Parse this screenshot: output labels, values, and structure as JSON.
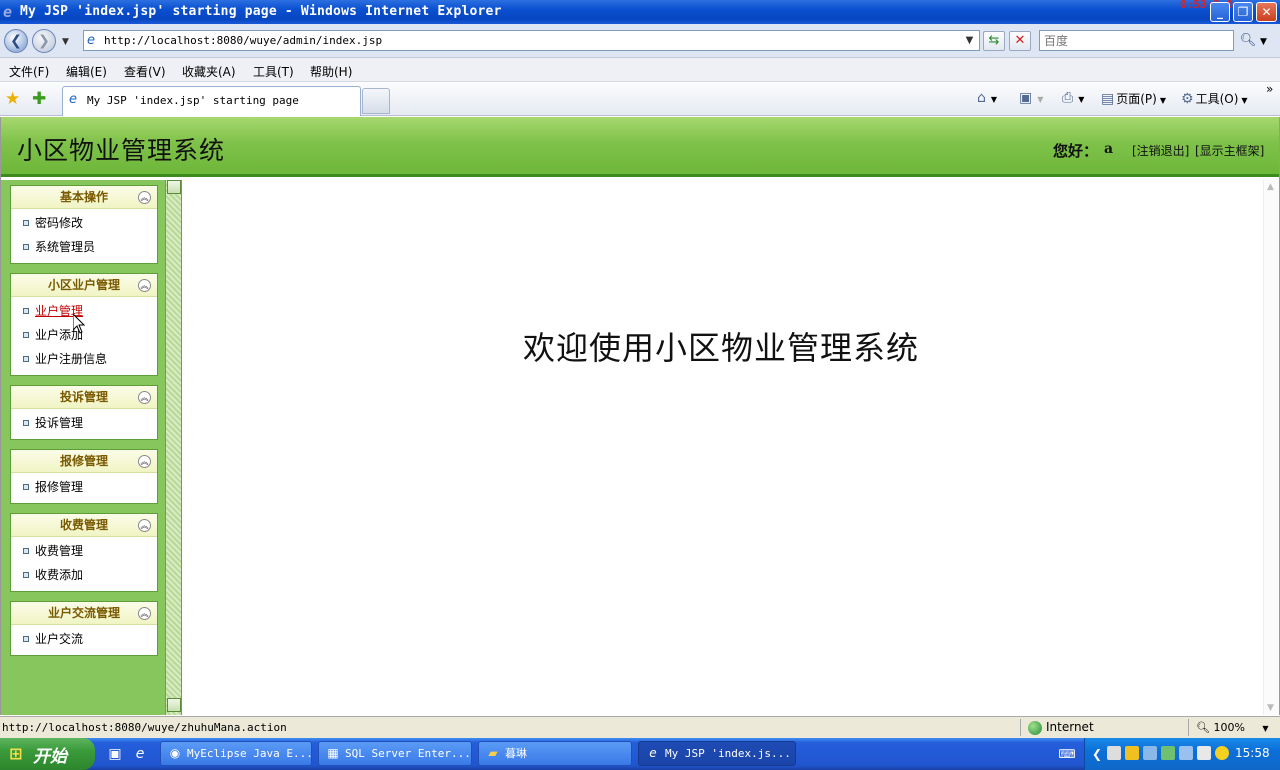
{
  "window": {
    "title": "My JSP 'index.jsp' starting page - Windows Internet Explorer",
    "timer": "0:53:3:0"
  },
  "address": {
    "url": "http://localhost:8080/wuye/admin/index.jsp",
    "search_placeholder": "百度"
  },
  "menubar": [
    "文件(F)",
    "编辑(E)",
    "查看(V)",
    "收藏夹(A)",
    "工具(T)",
    "帮助(H)"
  ],
  "tab": {
    "label": "My JSP 'index.jsp' starting page"
  },
  "commandbar": {
    "page": "页面(P)",
    "tools": "工具(O)"
  },
  "header": {
    "title": "小区物业管理系统",
    "greeting": "您好：",
    "username": "a",
    "logout": "[注销退出]",
    "show_frame": "[显示主框架]"
  },
  "sidebar": {
    "groups": [
      {
        "title": "基本操作",
        "items": [
          "密码修改",
          "系统管理员"
        ]
      },
      {
        "title": "小区业户管理",
        "items": [
          "业户管理",
          "业户添加",
          "业户注册信息"
        ]
      },
      {
        "title": "投诉管理",
        "items": [
          "投诉管理"
        ]
      },
      {
        "title": "报修管理",
        "items": [
          "报修管理"
        ]
      },
      {
        "title": "收费管理",
        "items": [
          "收费管理",
          "收费添加"
        ]
      },
      {
        "title": "业户交流管理",
        "items": [
          "业户交流"
        ]
      }
    ],
    "active_item": "业户管理"
  },
  "main": {
    "welcome": "欢迎使用小区物业管理系统"
  },
  "status": {
    "url": "http://localhost:8080/wuye/zhuhuMana.action",
    "zone": "Internet",
    "zoom": "100%"
  },
  "taskbar": {
    "start": "开始",
    "items": [
      "MyEclipse Java E...",
      "SQL Server Enter...",
      "暮琳",
      "My JSP 'index.js..."
    ],
    "clock": "15:58"
  },
  "colors": {
    "header_green": "#7fc24a",
    "menu_green": "#87c65c",
    "group_title": "#7a5a00",
    "active_link": "#c00000"
  }
}
